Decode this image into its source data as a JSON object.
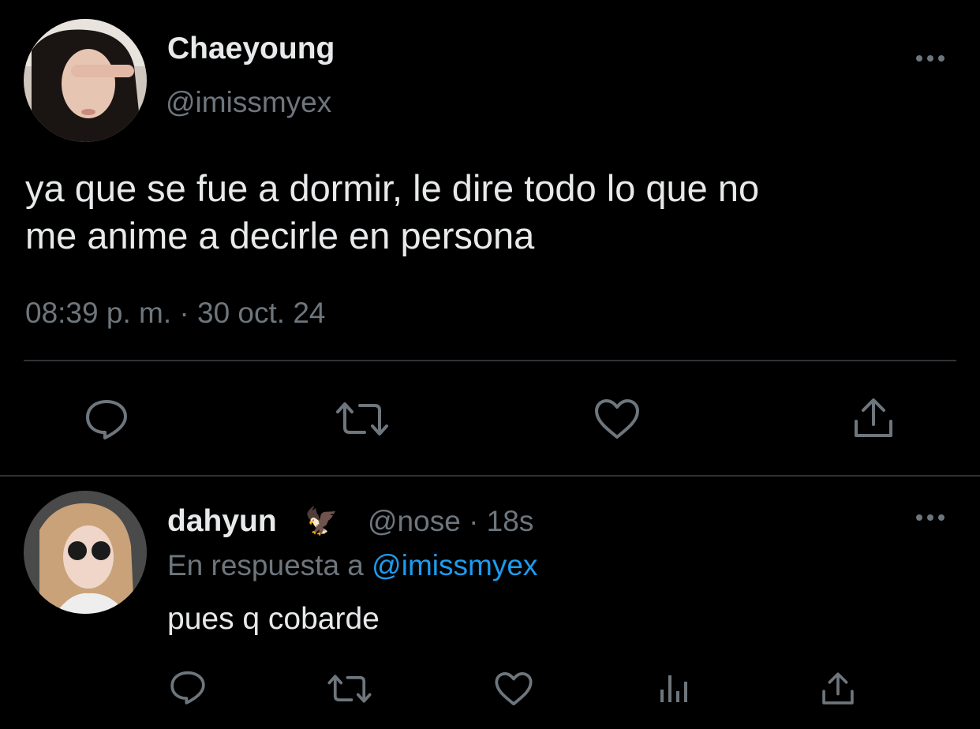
{
  "main_tweet": {
    "author_name": "Chaeyoung",
    "author_handle": "@imissmyex",
    "text_line1": "ya que se fue a dormir, le dire todo lo que no",
    "text_line2": "me anime a decirle en persona",
    "timestamp": "08:39 p. m. · 30 oct. 24",
    "more_icon": "more-horizontal-icon",
    "actions": [
      "reply-icon",
      "retweet-icon",
      "like-icon",
      "share-icon"
    ]
  },
  "reply_tweet": {
    "author_name": "dahyun",
    "author_badge": "🦅",
    "meta": "@nose · 18s",
    "replying_prefix": "En respuesta a",
    "replying_to": "@imissmyex",
    "text": "pues q cobarde",
    "more_icon": "more-horizontal-icon",
    "actions": [
      "reply-icon",
      "retweet-icon",
      "like-icon",
      "views-icon",
      "share-icon"
    ]
  },
  "colors": {
    "background": "#000000",
    "text": "#e7e9ea",
    "muted": "#6e767d",
    "link": "#1d9bf0",
    "divider": "#2f3336"
  }
}
